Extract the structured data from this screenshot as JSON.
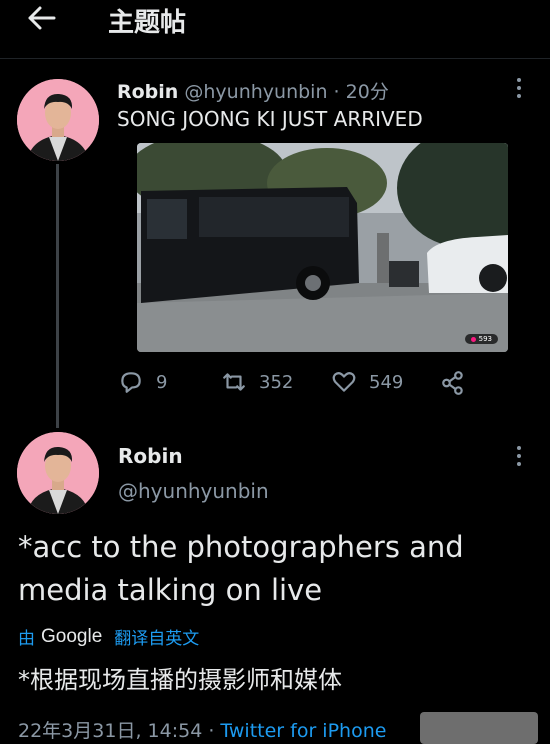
{
  "header": {
    "title": "主题帖"
  },
  "tweet1": {
    "display_name": "Robin",
    "handle": "@hyunhyunbin",
    "separator": "·",
    "time": "20分",
    "text": "SONG JOONG KI JUST ARRIVED",
    "media_badge": "593",
    "replies": "9",
    "retweets": "352",
    "likes": "549"
  },
  "tweet2": {
    "display_name": "Robin",
    "handle": "@hyunhyunbin",
    "text_line1": "*acc to the photographers and",
    "text_line2": "media talking on live",
    "translate_by": "由",
    "translate_provider": "Google",
    "translate_label": "翻译自英文",
    "translated_text": "*根据现场直播的摄影师和媒体",
    "date": "22年3月31日, 14:54",
    "separator": "·",
    "source": "Twitter for iPhone"
  },
  "icons": {
    "back": "arrow-left-icon",
    "more": "more-vertical-icon",
    "reply": "reply-icon",
    "retweet": "retweet-icon",
    "like": "heart-icon",
    "share": "share-icon"
  },
  "colors": {
    "accent": "#1d9bf0",
    "background": "#000000",
    "muted": "#8b98a5",
    "avatar_bg": "#f4a6b9"
  }
}
